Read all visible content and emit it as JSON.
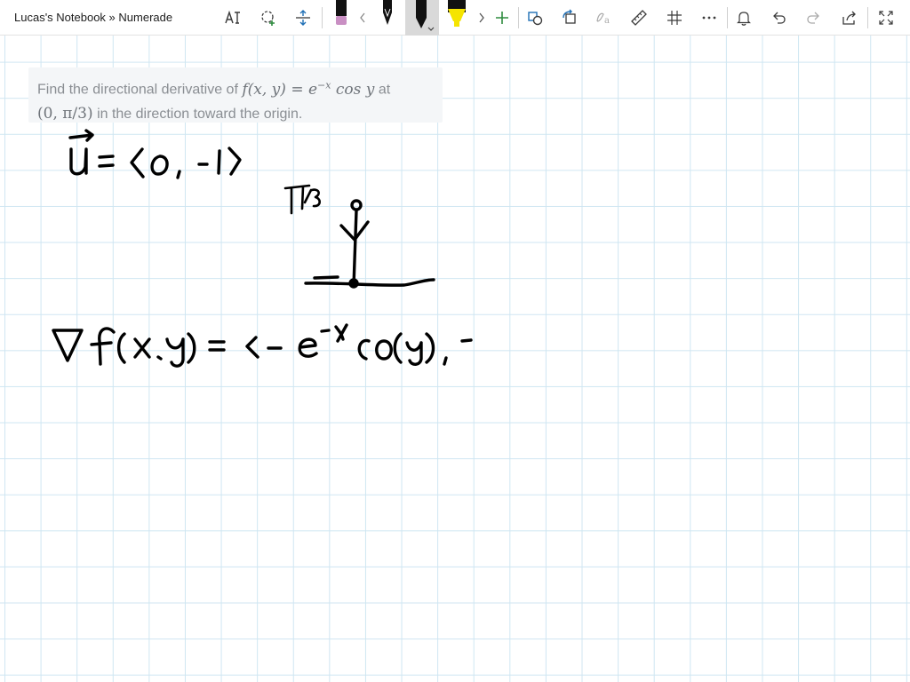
{
  "window": {
    "title": "Lucas's Notebook » Numerade"
  },
  "toolbar": {
    "tools": [
      "handwriting-to-text-icon",
      "lasso-select-icon",
      "add-space-icon",
      "pen-pink-icon",
      "scroll-left-icon",
      "pen-black-icon",
      "pen-black-selected-icon",
      "highlighter-yellow-icon",
      "scroll-right-icon",
      "add-pen-icon",
      "shapes-icon",
      "ink-to-shape-icon",
      "ink-to-math-icon",
      "ruler-icon",
      "grid-icon",
      "more-icon",
      "notifications-icon",
      "undo-icon",
      "redo-icon",
      "share-icon",
      "fullscreen-icon"
    ],
    "colors": {
      "pink_pen": "#c98fc3",
      "black_pen": "#000000",
      "yellow_highlighter": "#f5e400",
      "add": "#2e8b3e"
    }
  },
  "problem": {
    "prefix": "Find the directional derivative of",
    "function_lhs": "f(x, y) = e",
    "exponent": "−x",
    "function_rhs": " cos y",
    "mid": "at",
    "point": "(0, π/3)",
    "suffix": "in the direction toward the origin."
  },
  "canvas": {
    "grid_color": "#cfe6f2",
    "ink_color": "#000000"
  }
}
